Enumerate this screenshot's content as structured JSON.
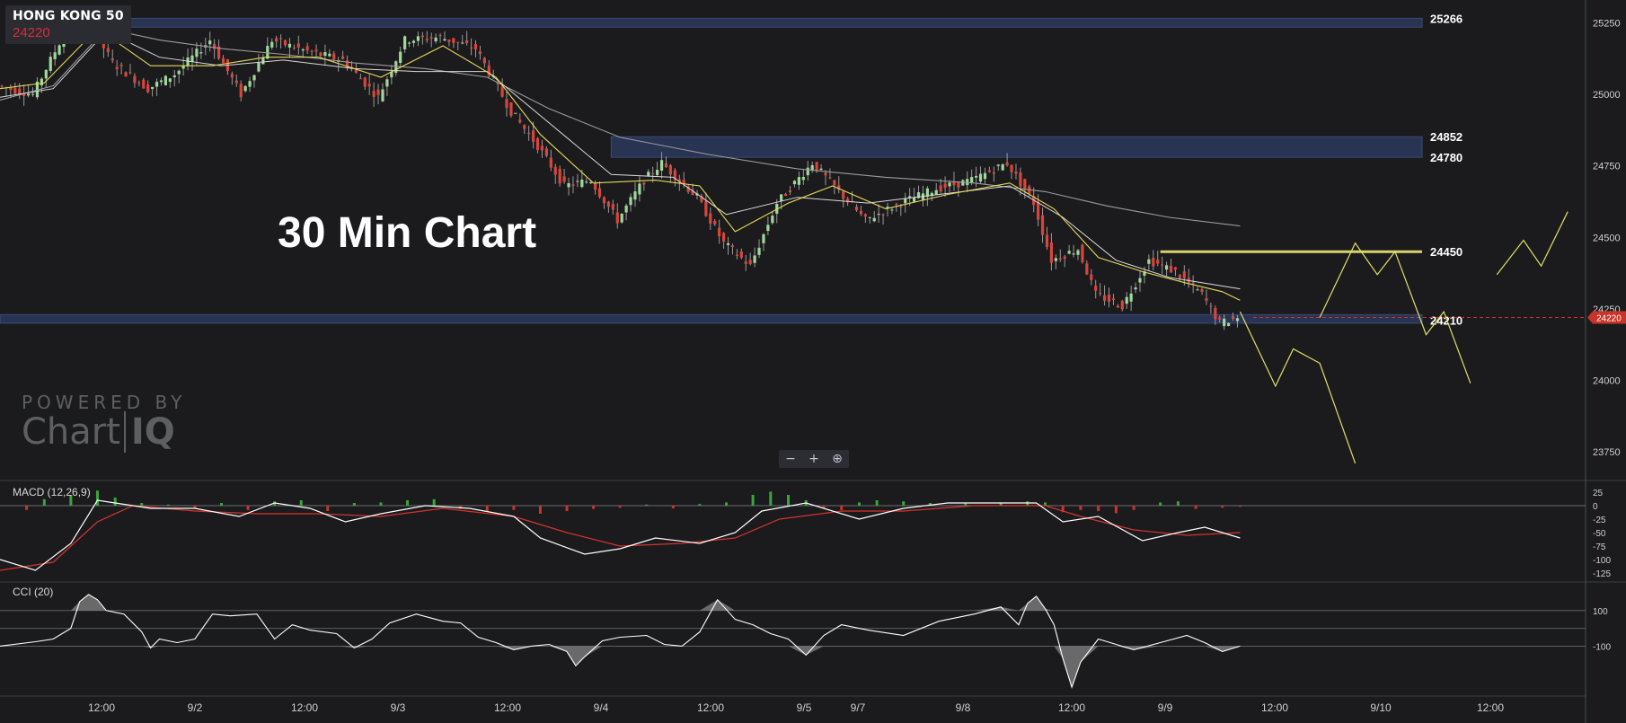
{
  "symbol": {
    "name": "HONG KONG 50",
    "last": "24220"
  },
  "title": "30 Min Chart",
  "zoom": {
    "out": "−",
    "in": "+",
    "reset": "⊕"
  },
  "branding": {
    "line1": "POWERED BY",
    "brand_a": "Chart",
    "brand_b": "IQ"
  },
  "colors": {
    "background": "#1b1b1d",
    "up": "#9ed99a",
    "down": "#d9453c",
    "zone": "#3b4f82",
    "resistance": "#d6d36b",
    "projection": "#e2df6a",
    "price_tag": "#c8342a"
  },
  "chart_data": [
    {
      "type": "candlestick",
      "symbol": "HONG KONG 50",
      "interval": "30 Min",
      "ylim": [
        23650,
        25330
      ],
      "y_ticks": [
        25250,
        25000,
        24750,
        24500,
        24250,
        24000,
        23750
      ],
      "x_tick_labels": [
        "12:00",
        "9/2",
        "12:00",
        "9/3",
        "12:00",
        "9/4",
        "12:00",
        "9/5",
        "9/7",
        "9/8",
        "12:00",
        "9/9",
        "12:00",
        "9/10",
        "12:00"
      ],
      "last_price": 24220,
      "path_points": [
        [
          0,
          25030
        ],
        [
          8,
          25000
        ],
        [
          15,
          25210
        ],
        [
          20,
          25270
        ],
        [
          26,
          25110
        ],
        [
          34,
          25020
        ],
        [
          40,
          25070
        ],
        [
          48,
          25190
        ],
        [
          55,
          25000
        ],
        [
          62,
          25190
        ],
        [
          70,
          25150
        ],
        [
          78,
          25120
        ],
        [
          86,
          24990
        ],
        [
          92,
          25190
        ],
        [
          100,
          25200
        ],
        [
          108,
          25160
        ],
        [
          116,
          24940
        ],
        [
          122,
          24820
        ],
        [
          128,
          24680
        ],
        [
          134,
          24700
        ],
        [
          140,
          24560
        ],
        [
          146,
          24700
        ],
        [
          150,
          24760
        ],
        [
          158,
          24640
        ],
        [
          164,
          24480
        ],
        [
          170,
          24400
        ],
        [
          176,
          24620
        ],
        [
          184,
          24760
        ],
        [
          190,
          24660
        ],
        [
          196,
          24560
        ],
        [
          204,
          24620
        ],
        [
          212,
          24670
        ],
        [
          220,
          24700
        ],
        [
          228,
          24760
        ],
        [
          234,
          24620
        ],
        [
          238,
          24420
        ],
        [
          244,
          24460
        ],
        [
          248,
          24300
        ],
        [
          254,
          24260
        ],
        [
          260,
          24420
        ],
        [
          266,
          24380
        ],
        [
          272,
          24300
        ],
        [
          276,
          24200
        ],
        [
          280,
          24220
        ]
      ],
      "ma_fast": [
        [
          0,
          25020
        ],
        [
          10,
          25040
        ],
        [
          22,
          25230
        ],
        [
          34,
          25100
        ],
        [
          48,
          25100
        ],
        [
          60,
          25130
        ],
        [
          72,
          25130
        ],
        [
          86,
          25060
        ],
        [
          100,
          25170
        ],
        [
          112,
          25060
        ],
        [
          122,
          24860
        ],
        [
          134,
          24690
        ],
        [
          148,
          24700
        ],
        [
          158,
          24680
        ],
        [
          166,
          24520
        ],
        [
          178,
          24620
        ],
        [
          188,
          24680
        ],
        [
          200,
          24600
        ],
        [
          214,
          24650
        ],
        [
          228,
          24690
        ],
        [
          238,
          24600
        ],
        [
          248,
          24430
        ],
        [
          258,
          24380
        ],
        [
          268,
          24340
        ],
        [
          276,
          24310
        ],
        [
          280,
          24280
        ]
      ],
      "ma_slow": [
        [
          0,
          24980
        ],
        [
          12,
          25030
        ],
        [
          24,
          25230
        ],
        [
          36,
          25190
        ],
        [
          50,
          25160
        ],
        [
          64,
          25140
        ],
        [
          80,
          25110
        ],
        [
          96,
          25090
        ],
        [
          110,
          25060
        ],
        [
          124,
          24950
        ],
        [
          140,
          24850
        ],
        [
          160,
          24790
        ],
        [
          180,
          24740
        ],
        [
          200,
          24710
        ],
        [
          220,
          24690
        ],
        [
          236,
          24660
        ],
        [
          250,
          24610
        ],
        [
          264,
          24570
        ],
        [
          280,
          24540
        ]
      ],
      "ma_mid": [
        [
          0,
          24990
        ],
        [
          12,
          25020
        ],
        [
          24,
          25220
        ],
        [
          36,
          25130
        ],
        [
          50,
          25100
        ],
        [
          64,
          25120
        ],
        [
          80,
          25090
        ],
        [
          94,
          25080
        ],
        [
          110,
          25080
        ],
        [
          124,
          24900
        ],
        [
          138,
          24720
        ],
        [
          152,
          24710
        ],
        [
          164,
          24580
        ],
        [
          180,
          24640
        ],
        [
          196,
          24620
        ],
        [
          212,
          24650
        ],
        [
          228,
          24680
        ],
        [
          240,
          24570
        ],
        [
          252,
          24420
        ],
        [
          264,
          24360
        ],
        [
          280,
          24320
        ]
      ],
      "zones": [
        {
          "label": "25266",
          "high": 25266,
          "low": 25235,
          "start": 22
        },
        {
          "label": "24852",
          "high": 24852,
          "low": 24780,
          "start": 138
        },
        {
          "label": "24210",
          "high": 24230,
          "low": 24200,
          "start": 0
        }
      ],
      "zone_labels": [
        {
          "label": "25266",
          "value": 25266
        },
        {
          "label": "24852",
          "value": 24852
        },
        {
          "label": "24780",
          "value": 24780
        },
        {
          "label": "24210",
          "value": 24210
        }
      ],
      "resistance_line": {
        "label": "24450",
        "value": 24450,
        "start": 262
      },
      "projections": [
        [
          [
            280,
            24240
          ],
          [
            288,
            23980
          ],
          [
            292,
            24110
          ],
          [
            298,
            24060
          ],
          [
            306,
            23710
          ]
        ],
        [
          [
            298,
            24220
          ],
          [
            306,
            24480
          ],
          [
            311,
            24370
          ],
          [
            315,
            24450
          ],
          [
            322,
            24160
          ],
          [
            326,
            24240
          ],
          [
            332,
            23990
          ]
        ],
        [
          [
            338,
            24370
          ],
          [
            344,
            24490
          ],
          [
            348,
            24400
          ],
          [
            354,
            24590
          ]
        ]
      ]
    },
    {
      "type": "line",
      "title": "MACD (12,26,9)",
      "ylim": [
        -135,
        40
      ],
      "y_ticks": [
        25,
        0,
        -25,
        -50,
        -75,
        -100,
        -125
      ],
      "macd": [
        [
          0,
          -100
        ],
        [
          8,
          -120
        ],
        [
          16,
          -70
        ],
        [
          22,
          10
        ],
        [
          26,
          5
        ],
        [
          34,
          -5
        ],
        [
          44,
          -5
        ],
        [
          54,
          -20
        ],
        [
          62,
          5
        ],
        [
          70,
          -5
        ],
        [
          78,
          -30
        ],
        [
          86,
          -15
        ],
        [
          96,
          0
        ],
        [
          106,
          -5
        ],
        [
          116,
          -20
        ],
        [
          122,
          -60
        ],
        [
          132,
          -90
        ],
        [
          140,
          -80
        ],
        [
          148,
          -60
        ],
        [
          158,
          -70
        ],
        [
          166,
          -50
        ],
        [
          172,
          -10
        ],
        [
          182,
          5
        ],
        [
          194,
          -25
        ],
        [
          204,
          -5
        ],
        [
          214,
          5
        ],
        [
          224,
          5
        ],
        [
          234,
          5
        ],
        [
          240,
          -30
        ],
        [
          248,
          -20
        ],
        [
          258,
          -65
        ],
        [
          266,
          -50
        ],
        [
          272,
          -40
        ],
        [
          280,
          -60
        ]
      ],
      "signal": [
        [
          0,
          -120
        ],
        [
          12,
          -105
        ],
        [
          22,
          -30
        ],
        [
          30,
          0
        ],
        [
          44,
          -10
        ],
        [
          58,
          -15
        ],
        [
          72,
          -15
        ],
        [
          86,
          -20
        ],
        [
          100,
          -5
        ],
        [
          116,
          -20
        ],
        [
          128,
          -50
        ],
        [
          140,
          -75
        ],
        [
          154,
          -70
        ],
        [
          166,
          -60
        ],
        [
          176,
          -25
        ],
        [
          190,
          -10
        ],
        [
          204,
          -10
        ],
        [
          220,
          0
        ],
        [
          236,
          0
        ],
        [
          244,
          -20
        ],
        [
          256,
          -45
        ],
        [
          268,
          -55
        ],
        [
          280,
          -50
        ]
      ],
      "histogram": [
        [
          6,
          -8
        ],
        [
          10,
          12
        ],
        [
          16,
          20
        ],
        [
          22,
          28
        ],
        [
          26,
          15
        ],
        [
          32,
          5
        ],
        [
          38,
          2
        ],
        [
          44,
          -5
        ],
        [
          50,
          5
        ],
        [
          56,
          -8
        ],
        [
          62,
          8
        ],
        [
          68,
          10
        ],
        [
          74,
          -10
        ],
        [
          80,
          5
        ],
        [
          86,
          6
        ],
        [
          92,
          10
        ],
        [
          98,
          12
        ],
        [
          104,
          -6
        ],
        [
          110,
          -10
        ],
        [
          116,
          -8
        ],
        [
          122,
          -15
        ],
        [
          128,
          -10
        ],
        [
          134,
          -6
        ],
        [
          140,
          -4
        ],
        [
          146,
          2
        ],
        [
          152,
          -5
        ],
        [
          158,
          3
        ],
        [
          164,
          6
        ],
        [
          170,
          20
        ],
        [
          174,
          26
        ],
        [
          178,
          20
        ],
        [
          182,
          10
        ],
        [
          186,
          -5
        ],
        [
          190,
          -8
        ],
        [
          194,
          6
        ],
        [
          198,
          10
        ],
        [
          204,
          8
        ],
        [
          210,
          5
        ],
        [
          218,
          4
        ],
        [
          226,
          6
        ],
        [
          232,
          8
        ],
        [
          236,
          6
        ],
        [
          240,
          -12
        ],
        [
          244,
          -8
        ],
        [
          248,
          -10
        ],
        [
          252,
          -14
        ],
        [
          256,
          -8
        ],
        [
          262,
          6
        ],
        [
          266,
          8
        ],
        [
          270,
          -6
        ],
        [
          276,
          -4
        ],
        [
          280,
          -2
        ]
      ]
    },
    {
      "type": "area",
      "title": "CCI (20)",
      "ylim": [
        -380,
        260
      ],
      "y_ticks": [
        100,
        -100
      ],
      "bands": [
        100,
        0,
        -100
      ],
      "values": [
        [
          0,
          -100
        ],
        [
          8,
          -75
        ],
        [
          12,
          -60
        ],
        [
          16,
          0
        ],
        [
          18,
          150
        ],
        [
          20,
          190
        ],
        [
          22,
          160
        ],
        [
          24,
          100
        ],
        [
          28,
          80
        ],
        [
          32,
          -20
        ],
        [
          34,
          -110
        ],
        [
          36,
          -60
        ],
        [
          40,
          -80
        ],
        [
          44,
          -60
        ],
        [
          48,
          80
        ],
        [
          52,
          70
        ],
        [
          58,
          80
        ],
        [
          62,
          -60
        ],
        [
          66,
          20
        ],
        [
          70,
          -10
        ],
        [
          76,
          -30
        ],
        [
          80,
          -110
        ],
        [
          84,
          -60
        ],
        [
          88,
          30
        ],
        [
          94,
          80
        ],
        [
          100,
          40
        ],
        [
          104,
          30
        ],
        [
          108,
          -50
        ],
        [
          112,
          -80
        ],
        [
          116,
          -120
        ],
        [
          120,
          -100
        ],
        [
          124,
          -90
        ],
        [
          128,
          -130
        ],
        [
          130,
          -210
        ],
        [
          132,
          -160
        ],
        [
          136,
          -70
        ],
        [
          140,
          -50
        ],
        [
          146,
          -40
        ],
        [
          150,
          -90
        ],
        [
          154,
          -100
        ],
        [
          158,
          -20
        ],
        [
          162,
          160
        ],
        [
          166,
          50
        ],
        [
          170,
          20
        ],
        [
          174,
          -30
        ],
        [
          178,
          -60
        ],
        [
          182,
          -150
        ],
        [
          186,
          -40
        ],
        [
          190,
          20
        ],
        [
          196,
          -10
        ],
        [
          204,
          -40
        ],
        [
          212,
          40
        ],
        [
          220,
          80
        ],
        [
          226,
          120
        ],
        [
          230,
          20
        ],
        [
          232,
          140
        ],
        [
          234,
          180
        ],
        [
          236,
          110
        ],
        [
          238,
          20
        ],
        [
          240,
          -170
        ],
        [
          242,
          -330
        ],
        [
          244,
          -190
        ],
        [
          248,
          -60
        ],
        [
          252,
          -90
        ],
        [
          256,
          -120
        ],
        [
          262,
          -80
        ],
        [
          268,
          -40
        ],
        [
          272,
          -80
        ],
        [
          276,
          -130
        ],
        [
          280,
          -100
        ]
      ]
    }
  ]
}
